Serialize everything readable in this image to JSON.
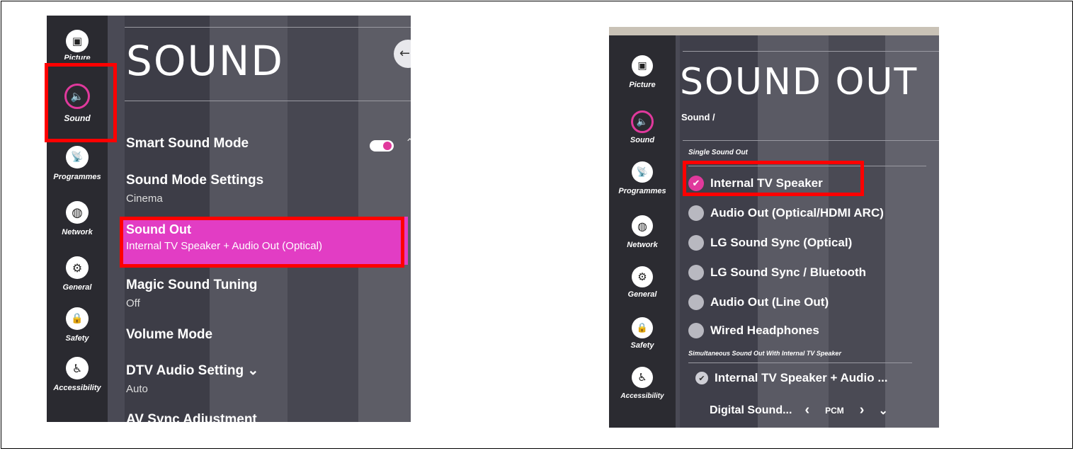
{
  "left": {
    "title": "SOUND",
    "sidebar": [
      {
        "label": "Picture",
        "icon": "picture-icon",
        "glyph": "▣"
      },
      {
        "label": "Sound",
        "icon": "speaker-icon",
        "glyph": "🔈"
      },
      {
        "label": "Programmes",
        "icon": "satellite-icon",
        "glyph": "📡"
      },
      {
        "label": "Network",
        "icon": "globe-icon",
        "glyph": "◍"
      },
      {
        "label": "General",
        "icon": "tools-icon",
        "glyph": "⚙"
      },
      {
        "label": "Safety",
        "icon": "lock-icon",
        "glyph": "🔒"
      },
      {
        "label": "Accessibility",
        "icon": "accessibility-icon",
        "glyph": "♿"
      }
    ],
    "menu": [
      {
        "label": "Smart Sound Mode",
        "sub": ""
      },
      {
        "label": "Sound Mode Settings",
        "sub": "Cinema"
      },
      {
        "label": "Sound Out",
        "sub": "Internal TV Speaker + Audio Out (Optical)"
      },
      {
        "label": "Magic Sound Tuning",
        "sub": "Off"
      },
      {
        "label": "Volume Mode",
        "sub": ""
      },
      {
        "label": "DTV Audio Setting ⌄",
        "sub": "Auto"
      },
      {
        "label": "AV Sync Adjustment",
        "sub": ""
      }
    ],
    "smart_sound_toggle": "on"
  },
  "right": {
    "title": "SOUND OUT",
    "breadcrumb": "Sound /",
    "sidebar": [
      {
        "label": "Picture",
        "icon": "picture-icon",
        "glyph": "▣"
      },
      {
        "label": "Sound",
        "icon": "speaker-icon",
        "glyph": "🔈"
      },
      {
        "label": "Programmes",
        "icon": "satellite-icon",
        "glyph": "📡"
      },
      {
        "label": "Network",
        "icon": "globe-icon",
        "glyph": "◍"
      },
      {
        "label": "General",
        "icon": "tools-icon",
        "glyph": "⚙"
      },
      {
        "label": "Safety",
        "icon": "lock-icon",
        "glyph": "🔒"
      },
      {
        "label": "Accessibility",
        "icon": "accessibility-icon",
        "glyph": "♿"
      }
    ],
    "single_label": "Single Sound Out",
    "single_options": [
      {
        "label": "Internal TV Speaker",
        "checked": true
      },
      {
        "label": "Audio Out (Optical/HDMI ARC)",
        "checked": false
      },
      {
        "label": "LG Sound Sync (Optical)",
        "checked": false
      },
      {
        "label": "LG Sound Sync / Bluetooth",
        "checked": false
      },
      {
        "label": "Audio Out (Line Out)",
        "checked": false
      },
      {
        "label": "Wired Headphones",
        "checked": false
      }
    ],
    "simultaneous_label": "Simultaneous Sound Out With Internal TV Speaker",
    "simultaneous_option": "Internal TV Speaker + Audio ...",
    "digital": {
      "label": "Digital Sound...",
      "value": "PCM",
      "prev": "‹",
      "next": "›"
    },
    "more": "⌄"
  },
  "colors": {
    "accent": "#e0399c",
    "highlight": "#e23dc4",
    "annotation": "#ff0000"
  }
}
